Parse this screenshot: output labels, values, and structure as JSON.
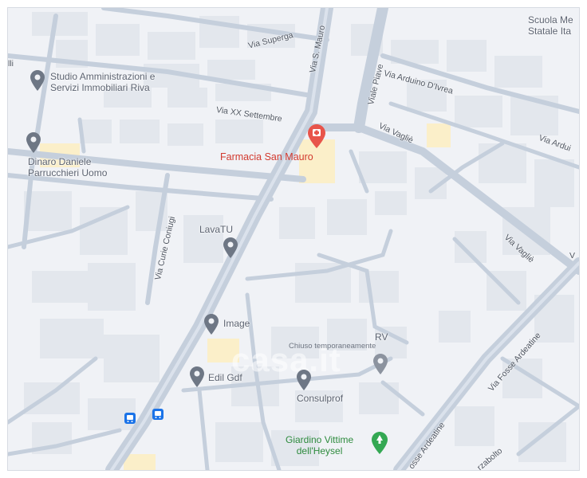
{
  "map": {
    "background": "#f0f2f6",
    "road_color": "#c5cfdc",
    "building_color": "#e2e6ec",
    "street_labels": {
      "via_superga": "Via Superga",
      "via_s_mauro": "Via S. Mauro",
      "viale_piave": "Viale Piave",
      "via_arduino_ivrea": "Via Arduino D'Ivrea",
      "via_arduino_right": "Via Ardui",
      "via_xx_settembre": "Via XX Settembre",
      "via_vaglie_top": "Via Vagliè",
      "via_vaglie_mid": "Via Vagliè",
      "via_curie_coniugi": "Via Curie Coniugi",
      "via_fosse_ardeatine": "Via Fosse Ardeatine",
      "fosse_ardeatine_bottom": "osse Ardeatine",
      "rzabolto": "rzabolto",
      "edge_lli": "lli",
      "edge_v": "V"
    },
    "places": {
      "scuola": {
        "line1": "Scuola Me",
        "line2": "Statale Ita"
      },
      "studio": {
        "line1": "Studio Amministrazioni e",
        "line2": "Servizi Immobiliari Riva",
        "icon": "location-pin-icon"
      },
      "dinaro": {
        "line1": "Dinaro Daniele",
        "line2": "Parrucchieri Uomo",
        "icon": "location-pin-icon"
      },
      "farmacia": {
        "name": "Farmacia San Mauro",
        "icon": "pharmacy-pin-icon",
        "color": "#e8544a"
      },
      "lavatu": {
        "name": "LavaTU",
        "icon": "location-pin-icon"
      },
      "image": {
        "name": "Image",
        "icon": "location-pin-icon"
      },
      "rv": {
        "name": "RV",
        "status": "Chiuso temporaneamente",
        "icon": "location-pin-icon"
      },
      "edil": {
        "name": "Edil Gdf",
        "icon": "location-pin-icon"
      },
      "consulprof": {
        "name": "Consulprof",
        "icon": "location-pin-icon"
      },
      "giardino": {
        "line1": "Giardino Vittime",
        "line2": "dell'Heysel",
        "icon": "park-pin-icon",
        "color": "#34a853"
      }
    },
    "transit": {
      "icon": "bus-stop-icon",
      "count": 2,
      "color": "#1a73e8"
    },
    "watermark": "casa.it"
  }
}
